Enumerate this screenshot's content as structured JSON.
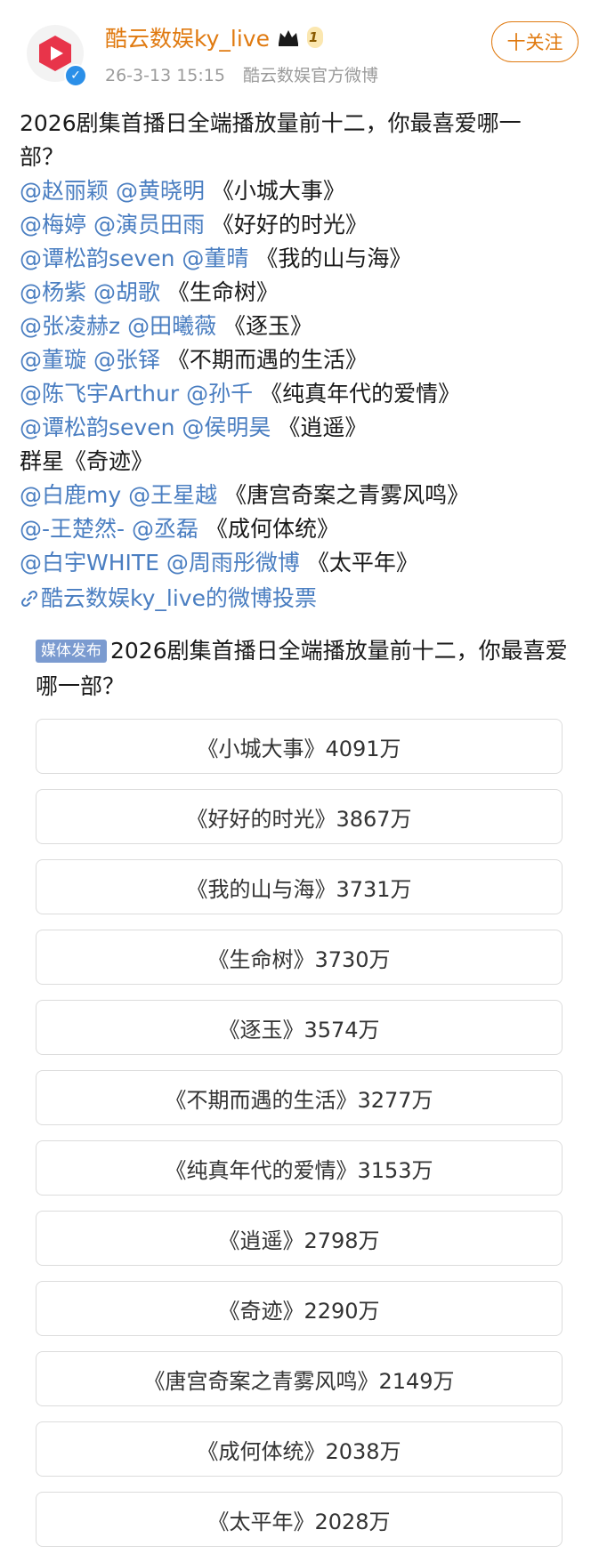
{
  "header": {
    "user_name": "酷云数娱ky_live",
    "vip_level": "1",
    "timestamp": "26-3-13 15:15",
    "source": "酷云数娱官方微博",
    "follow_label": "十关注"
  },
  "post": {
    "lines": [
      "2026剧集首播日全端播放量前十二，你最喜爱哪一",
      "部？",
      "@赵丽颖 @黄晓明 《小城大事》",
      "@梅婷 @演员田雨 《好好的时光》",
      "@谭松韵seven @董晴 《我的山与海》",
      "@杨紫 @胡歌 《生命树》",
      "@张凌赫z @田曦薇 《逐玉》",
      "@董璇 @张铎 《不期而遇的生活》",
      "@陈飞宇Arthur @孙千 《纯真年代的爱情》",
      "@谭松韵seven @侯明昊 《逍遥》",
      "群星《奇迹》",
      "@白鹿my @王星越 《唐宫奇案之青雾风鸣》",
      "@-王楚然- @丞磊 《成何体统》",
      "@白宇WHITE @周雨彤微博 《太平年》"
    ],
    "vote_link": "酷云数娱ky_live的微博投票"
  },
  "poll": {
    "badge": "媒体发布",
    "title": "2026剧集首播日全端播放量前十二，你最喜爱哪一部？",
    "options": [
      "《小城大事》4091万",
      "《好好的时光》3867万",
      "《我的山与海》3731万",
      "《生命树》3730万",
      "《逐玉》3574万",
      "《不期而遇的生活》3277万",
      "《纯真年代的爱情》3153万",
      "《逍遥》2798万",
      "《奇迹》2290万",
      "《唐宫奇案之青雾风鸣》2149万",
      "《成何体统》2038万",
      "《太平年》2028万"
    ]
  },
  "colors": {
    "accent": "#e07a10",
    "mention": "#4a7ec1",
    "badge": "#7b9bd0"
  }
}
